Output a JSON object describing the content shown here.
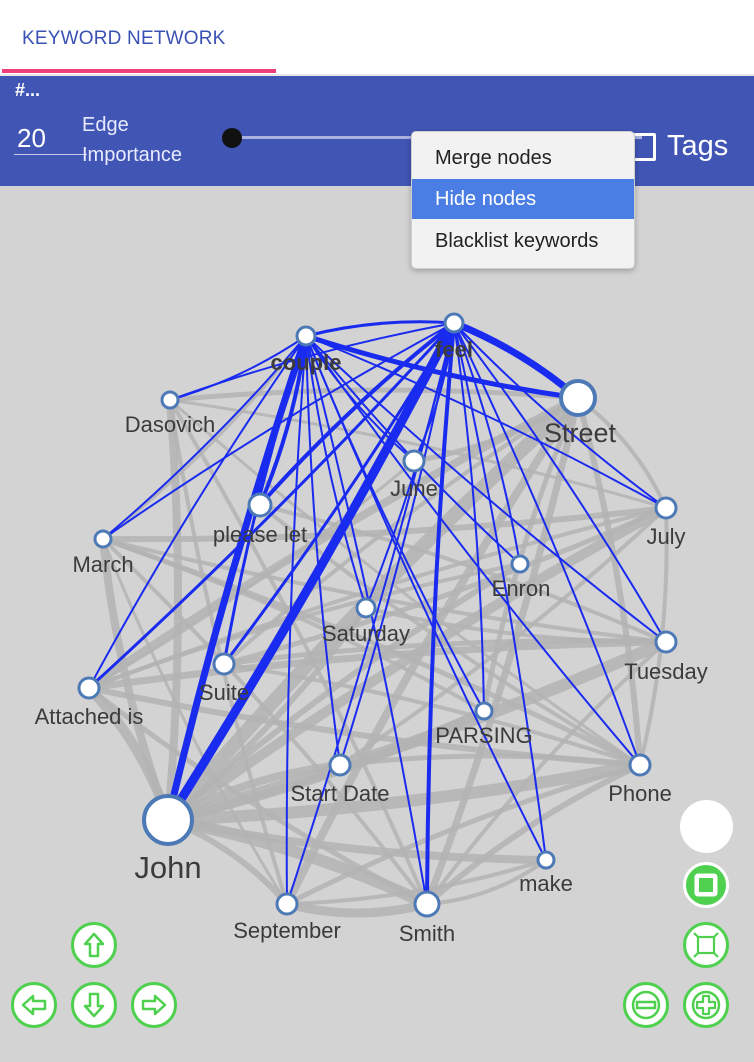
{
  "tab": {
    "label": "KEYWORD NETWORK"
  },
  "toolbar": {
    "hash": "#...",
    "edge_value": "20",
    "edge_label_line1": "Edge",
    "edge_label_line2": "Importance",
    "tags_label": "Tags"
  },
  "context_menu": {
    "items": [
      "Merge nodes",
      "Hide nodes",
      "Blacklist keywords"
    ],
    "active": "Hide nodes"
  },
  "colors": {
    "primary": "#4155b5",
    "accent": "#ee3f79",
    "highlight_edge": "#1a2bf0",
    "gray_edge": "#b3b3b3",
    "canvas": "#d3d3d3",
    "menu_active": "#4a7ee4",
    "nav_button_border": "#4fd14f"
  },
  "graph": {
    "nodes": [
      {
        "id": "couple",
        "label": "couple",
        "bold": true
      },
      {
        "id": "feel",
        "label": "feel",
        "bold": true
      },
      {
        "id": "Street",
        "label": "Street"
      },
      {
        "id": "Dasovich",
        "label": "Dasovich"
      },
      {
        "id": "June",
        "label": "June"
      },
      {
        "id": "please let",
        "label": "please let"
      },
      {
        "id": "July",
        "label": "July"
      },
      {
        "id": "March",
        "label": "March"
      },
      {
        "id": "Enron",
        "label": "Enron"
      },
      {
        "id": "Saturday",
        "label": "Saturday"
      },
      {
        "id": "Tuesday",
        "label": "Tuesday"
      },
      {
        "id": "Suite",
        "label": "Suite"
      },
      {
        "id": "Attached is",
        "label": "Attached is"
      },
      {
        "id": "PARSING",
        "label": "PARSING"
      },
      {
        "id": "Start Date",
        "label": "Start Date"
      },
      {
        "id": "Phone",
        "label": "Phone"
      },
      {
        "id": "John",
        "label": "John"
      },
      {
        "id": "make",
        "label": "make"
      },
      {
        "id": "September",
        "label": "September"
      },
      {
        "id": "Smith",
        "label": "Smith"
      }
    ]
  },
  "controls": {
    "icons": [
      "arrow-up-icon",
      "arrow-left-icon",
      "arrow-down-icon",
      "arrow-right-icon",
      "zoom-out-icon",
      "zoom-in-icon",
      "fit-to-screen-icon",
      "fullscreen-icon"
    ]
  }
}
